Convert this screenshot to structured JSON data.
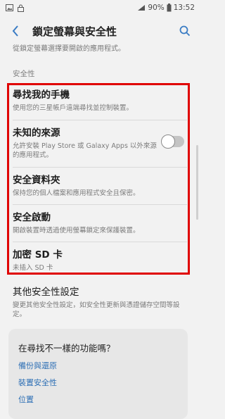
{
  "status": {
    "battery": "90%",
    "time": "13:52"
  },
  "header": {
    "title": "鎖定螢幕與安全性"
  },
  "cutoff_text": "從鎖定螢幕選擇要開啟的應用程式。",
  "section": {
    "title": "安全性"
  },
  "items": [
    {
      "title": "尋找我的手機",
      "subtitle": "使用您的三星帳戶遠端尋找並控制裝置。"
    },
    {
      "title": "未知的來源",
      "subtitle": "允許安裝 Play Store 或 Galaxy Apps 以外來源的應用程式。",
      "toggle_on": false
    },
    {
      "title": "安全資料夾",
      "subtitle": "保持您的個人檔案和應用程式安全且保密。"
    },
    {
      "title": "安全啟動",
      "subtitle": "開啟裝置時透過使用螢幕鎖定來保護裝置。"
    },
    {
      "title": "加密 SD 卡",
      "subtitle": "未插入 SD 卡"
    },
    {
      "title": "其他安全性設定",
      "subtitle": "變更其他安全性設定，如安全性更新與憑證儲存空間等設定。"
    }
  ],
  "suggestions": {
    "title": "在尋找不一樣的功能嗎？",
    "links": [
      "備份與還原",
      "裝置安全性",
      "位置"
    ]
  }
}
